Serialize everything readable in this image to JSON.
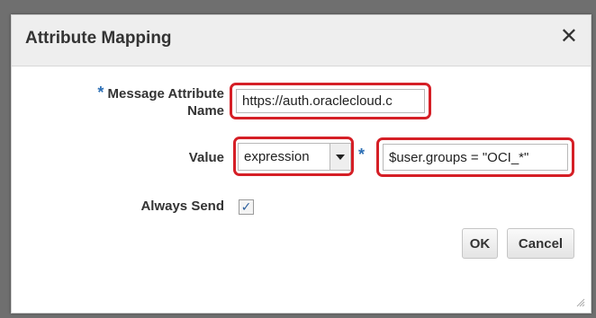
{
  "dialog": {
    "title": "Attribute Mapping",
    "close_symbol": "✕"
  },
  "form": {
    "message_attribute_name": {
      "required_marker": "*",
      "label_line1": "Message Attribute",
      "label_line2": "Name",
      "value": "https://auth.oraclecloud.c"
    },
    "value": {
      "label": "Value",
      "select_value": "expression",
      "required_marker": "*",
      "expression_value": "$user.groups = \"OCI_*\""
    },
    "always_send": {
      "label": "Always Send",
      "checked": true,
      "check_symbol": "✓"
    }
  },
  "buttons": {
    "ok_label": "OK",
    "cancel_label": "Cancel"
  },
  "icons": {
    "close": "close-icon",
    "dropdown": "chevron-down-icon",
    "checkmark": "check-icon",
    "resize": "resize-grip-icon"
  },
  "colors": {
    "highlight": "#d51f26",
    "required": "#2c6fb5"
  }
}
